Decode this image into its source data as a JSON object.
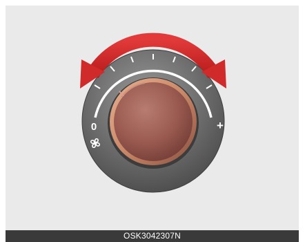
{
  "dial": {
    "min_label": "0",
    "max_label": "+",
    "fan_icon": "fan-icon",
    "arrow_icon": "curved-double-arrow-icon"
  },
  "colors": {
    "knob": "#9a5a50",
    "knob_ring": "#c98868",
    "arrow": "#d02a2a",
    "bezel": "#5f5f5f"
  },
  "caption": "OSK3042307N"
}
